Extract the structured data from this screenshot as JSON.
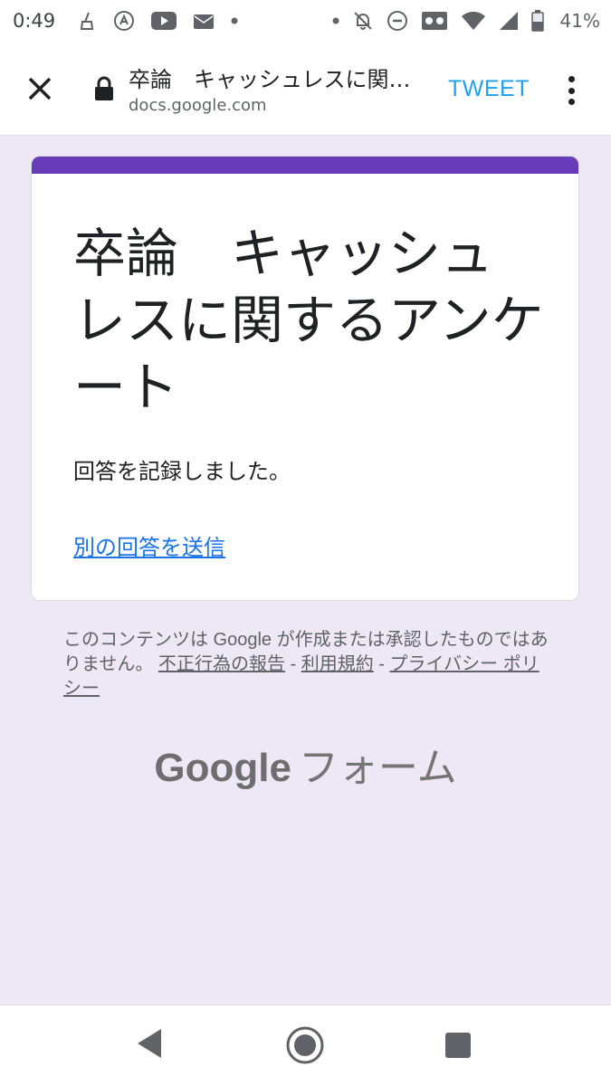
{
  "status_bar": {
    "time": "0:49",
    "battery": "41%"
  },
  "browser": {
    "page_title": "卒論　キャッシュレスに関するアンケート",
    "url": "docs.google.com",
    "tweet_label": "TWEET"
  },
  "form": {
    "title": "卒論　キャッシュレスに関するアンケート",
    "confirmation": "回答を記録しました。",
    "another_response_link": "別の回答を送信"
  },
  "disclaimer": {
    "text": "このコンテンツは Google が作成または承認したものではありません。",
    "report_link": "不正行為の報告",
    "separator1": " - ",
    "terms_link": "利用規約",
    "separator2": " - ",
    "privacy_link": "プライバシー ポリシー"
  },
  "footer_logo": {
    "google": "Google",
    "forms": "フォーム"
  },
  "colors": {
    "accent": "#673ab7",
    "background": "#ede7f6",
    "link": "#1a73e8",
    "tweet": "#1da1f2"
  }
}
